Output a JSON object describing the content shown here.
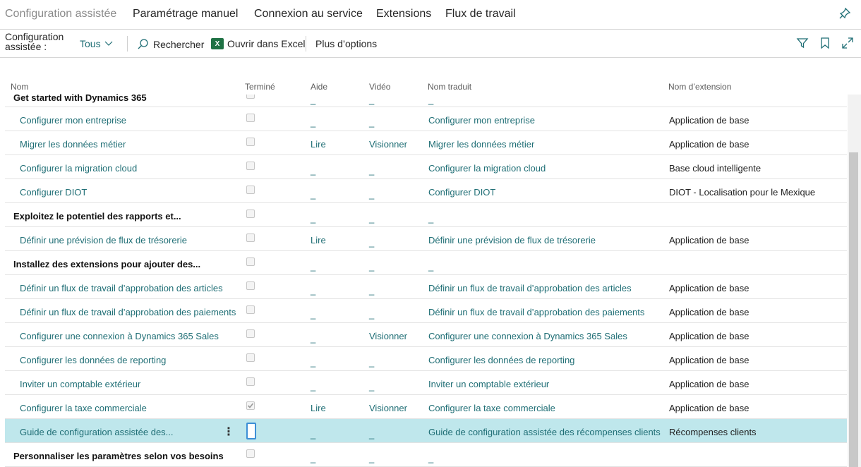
{
  "topnav": {
    "tabs": [
      {
        "label": "Configuration assistée",
        "active": true
      },
      {
        "label": "Paramétrage manuel",
        "active": false
      },
      {
        "label": "Connexion au service",
        "active": false
      },
      {
        "label": "Extensions",
        "active": false
      },
      {
        "label": "Flux de travail",
        "active": false
      }
    ],
    "pin_icon": "pin-icon"
  },
  "actionbar": {
    "label": "Configuration assistée :",
    "filter_value": "Tous",
    "search_label": "Rechercher",
    "excel_label": "Ouvrir dans Excel",
    "excel_icon_text": "X",
    "more_label": "Plus d’options",
    "icons": [
      "filter-icon",
      "bookmark-icon",
      "expand-icon"
    ]
  },
  "columns": {
    "name": "Nom",
    "done": "Terminé",
    "help": "Aide",
    "video": "Vidéo",
    "translated": "Nom traduit",
    "extension": "Nom d’extension"
  },
  "dash": "_",
  "rows": [
    {
      "name": "Get started with Dynamics 365",
      "kind": "group",
      "done": false,
      "help": "_",
      "video": "_",
      "translated": "_",
      "extension": ""
    },
    {
      "name": "Configurer mon entreprise",
      "kind": "link",
      "done": false,
      "help": "_",
      "video": "_",
      "translated": "Configurer mon entreprise",
      "extension": "Application de base"
    },
    {
      "name": "Migrer les données métier",
      "kind": "link",
      "done": false,
      "help": "Lire",
      "video": "Visionner",
      "translated": "Migrer les données métier",
      "extension": "Application de base"
    },
    {
      "name": "Configurer la migration cloud",
      "kind": "link",
      "done": false,
      "help": "_",
      "video": "_",
      "translated": "Configurer la migration cloud",
      "extension": "Base cloud intelligente"
    },
    {
      "name": "Configurer DIOT",
      "kind": "link",
      "done": false,
      "help": "_",
      "video": "_",
      "translated": "Configurer DIOT",
      "extension": "DIOT - Localisation pour le Mexique"
    },
    {
      "name": "Exploitez le potentiel des rapports et...",
      "kind": "group",
      "done": false,
      "help": "_",
      "video": "_",
      "translated": "_",
      "extension": ""
    },
    {
      "name": "Définir une prévision de flux de trésorerie",
      "kind": "link",
      "done": false,
      "help": "Lire",
      "video": "_",
      "translated": "Définir une prévision de flux de trésorerie",
      "extension": "Application de base"
    },
    {
      "name": "Installez des extensions pour ajouter des...",
      "kind": "group",
      "done": false,
      "help": "_",
      "video": "_",
      "translated": "_",
      "extension": ""
    },
    {
      "name": "Définir un flux de travail d’approbation des articles",
      "kind": "link",
      "done": false,
      "help": "_",
      "video": "_",
      "translated": "Définir un flux de travail d’approbation des articles",
      "extension": "Application de base"
    },
    {
      "name": "Définir un flux de travail d’approbation des paiements",
      "kind": "link",
      "done": false,
      "help": "_",
      "video": "_",
      "translated": "Définir un flux de travail d’approbation des paiements",
      "extension": "Application de base"
    },
    {
      "name": "Configurer une connexion à Dynamics 365 Sales",
      "kind": "link",
      "done": false,
      "help": "_",
      "video": "Visionner",
      "translated": "Configurer une connexion à Dynamics 365 Sales",
      "extension": "Application de base"
    },
    {
      "name": "Configurer les données de reporting",
      "kind": "link",
      "done": false,
      "help": "_",
      "video": "_",
      "translated": "Configurer les données de reporting",
      "extension": "Application de base"
    },
    {
      "name": "Inviter un comptable extérieur",
      "kind": "link",
      "done": false,
      "help": "_",
      "video": "_",
      "translated": "Inviter un comptable extérieur",
      "extension": "Application de base"
    },
    {
      "name": "Configurer la taxe commerciale",
      "kind": "link",
      "done": true,
      "help": "Lire",
      "video": "Visionner",
      "translated": "Configurer la taxe commerciale",
      "extension": "Application de base"
    },
    {
      "name": "Guide de configuration assistée des...",
      "kind": "link",
      "done": false,
      "selected": true,
      "help": "_",
      "video": "_",
      "translated": "Guide de configuration assistée des récompenses clients",
      "extension": "Récompenses clients"
    },
    {
      "name": "Personnaliser les paramètres selon vos besoins",
      "kind": "group",
      "done": false,
      "help": "_",
      "video": "_",
      "translated": "_",
      "extension": ""
    }
  ]
}
